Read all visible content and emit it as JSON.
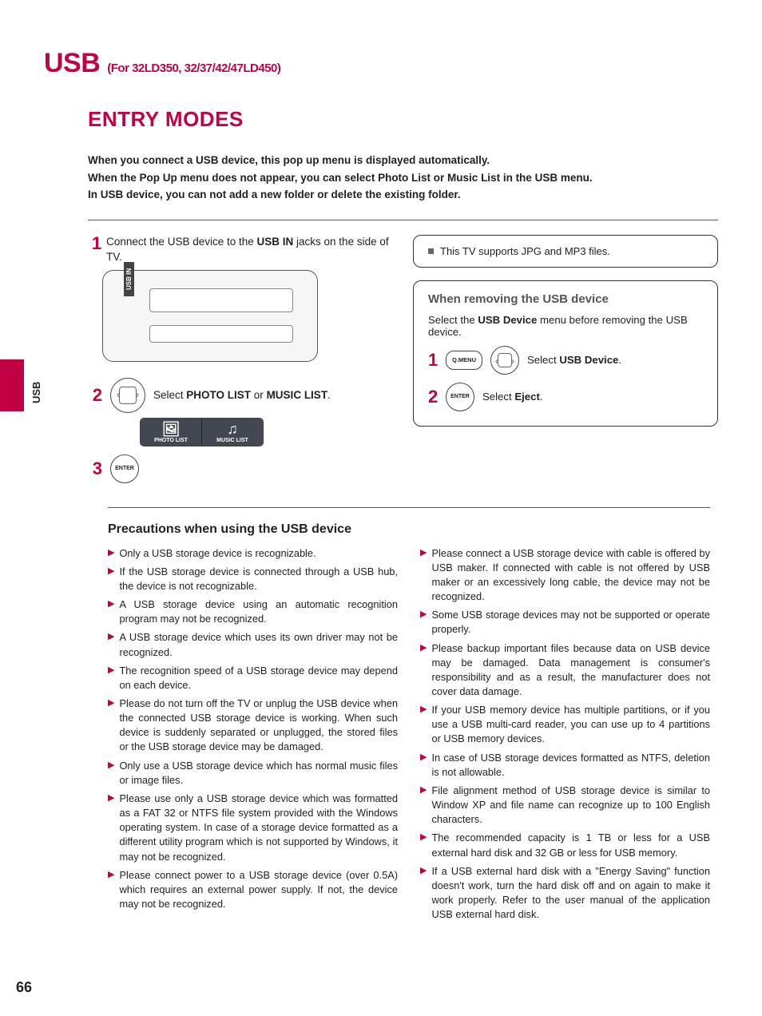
{
  "header": {
    "title": "USB",
    "subtitle": "(For 32LD350, 32/37/42/47LD450)"
  },
  "side_label": "USB",
  "page_number": "66",
  "section_title": "ENTRY MODES",
  "intro_lines": [
    "When you connect a USB device, this pop up menu is displayed automatically.",
    "When the Pop Up menu does not appear, you can select Photo List or Music List in the USB menu.",
    "In USB device, you can not add a new folder or delete the existing folder."
  ],
  "steps": {
    "s1_num": "1",
    "s1": "Connect the USB device to the USB IN jacks on the side of TV.",
    "usb_in_label": "USB IN",
    "s2_num": "2",
    "s2_pre": "Select ",
    "s2_b1": "PHOTO LIST",
    "s2_mid": " or ",
    "s2_b2": "MUSIC LIST",
    "s2_post": ".",
    "menu_photo": "PHOTO LIST",
    "menu_music": "MUSIC LIST",
    "s3_num": "3",
    "enter_label": "ENTER"
  },
  "note": "This TV supports JPG and MP3 files.",
  "remove": {
    "title": "When removing the USB device",
    "desc_pre": "Select the ",
    "desc_b": "USB Device",
    "desc_post": " menu before removing the USB device.",
    "r1_num": "1",
    "qmenu": "Q.MENU",
    "r1_pre": "Select ",
    "r1_b": "USB Device",
    "r1_post": ".",
    "r2_num": "2",
    "enter_label": "ENTER",
    "r2_pre": "Select ",
    "r2_b": "Eject",
    "r2_post": "."
  },
  "precautions_title": "Precautions when using the USB device",
  "precautions_left": [
    "Only a USB storage device is recognizable.",
    "If the USB storage device is connected through a USB hub, the device is not recognizable.",
    "A USB storage device using an automatic recognition program may not be recognized.",
    "A USB storage device which uses its own driver may not be recognized.",
    "The recognition speed of a USB storage device may depend on each device.",
    "Please do not turn off the TV or unplug the USB device when the connected USB storage device is working.  When such device is suddenly separated or unplugged, the stored files or the USB storage device may be damaged.",
    " Only use a USB storage device which has normal music files or image files.",
    "Please use only a USB storage device which was formatted as a FAT 32 or NTFS file system provided with the Windows operating system.  In case of a storage device formatted as a different utility program which is not supported by Windows, it may not be recognized.",
    "Please connect power to a USB storage device (over 0.5A) which requires an external power supply.  If not, the device may not be recognized."
  ],
  "precautions_right": [
    "Please connect a USB storage device with cable is offered by USB maker.  If connected with cable is not offered by USB maker or an excessively long cable, the device may not be recognized.",
    "Some USB storage devices may not be supported or operate properly.",
    "Please backup important files because data on USB device may be damaged. Data management is consumer's responsibility and as a result, the manufacturer does not cover data damage.",
    "If your USB memory device has multiple partitions, or if you use a USB multi-card reader, you can use up to 4 partitions or USB memory devices.",
    "In case of USB storage devices formatted as NTFS, deletion is not allowable.",
    "File alignment method of USB storage device is similar to Window XP and file name can recognize up to 100 English characters.",
    "The recommended capacity is 1 TB or less for a USB external hard disk and 32 GB or less for USB memory.",
    "If a USB external hard disk with a \"Energy Saving\" function doesn't work, turn the hard disk off and on again to make it work properly. Refer to the user manual of the application USB external hard disk."
  ]
}
